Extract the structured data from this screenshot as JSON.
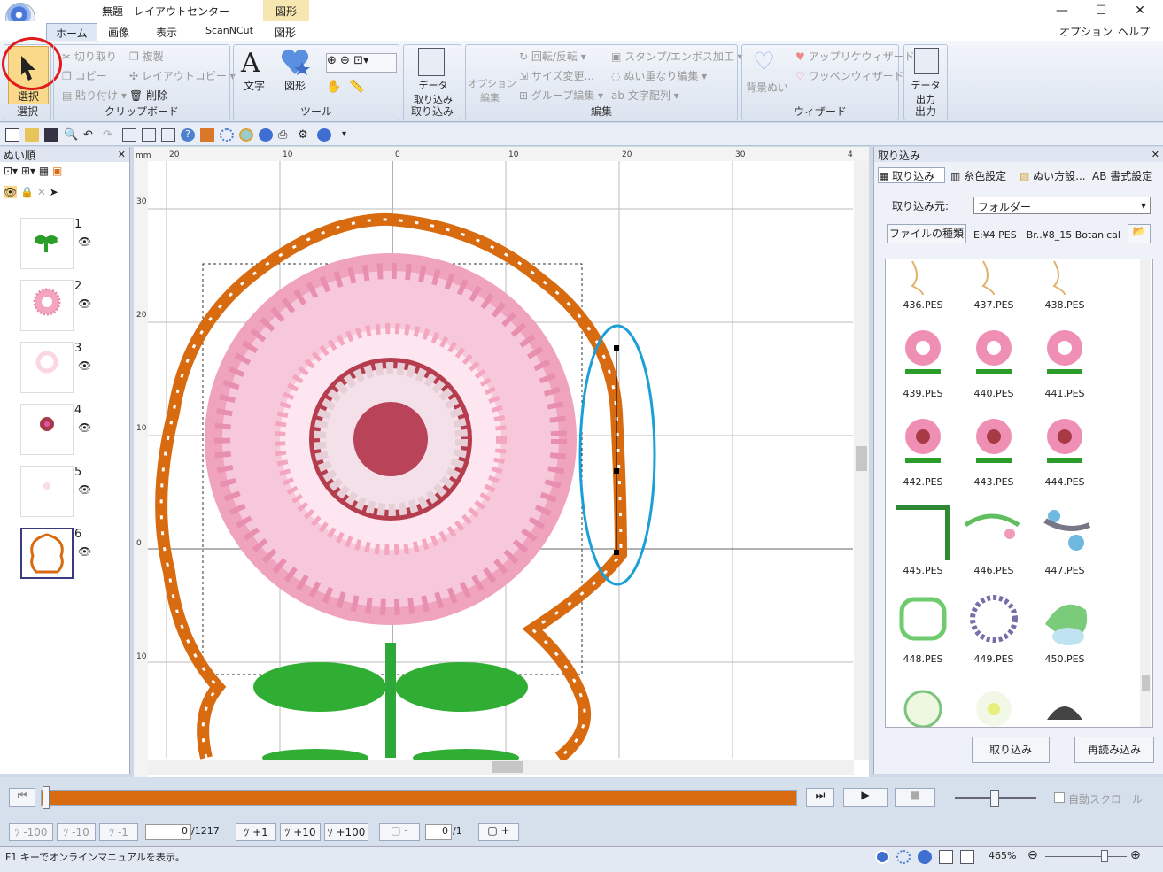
{
  "window": {
    "title": "無題 - レイアウトセンター",
    "context_tab": "図形",
    "minimize": "—",
    "maximize": "☐",
    "close": "✕"
  },
  "tabs": [
    "ホーム",
    "画像",
    "表示",
    "ScanNCut",
    "図形"
  ],
  "menu_right": {
    "options": "オプション",
    "help": "ヘルプ"
  },
  "ribbon": {
    "select": {
      "label": "選択",
      "group": "選択"
    },
    "clipboard": {
      "cut": "切り取り",
      "copy": "コピー",
      "paste": "貼り付け",
      "duplicate": "複製",
      "layout_copy": "レイアウトコピー",
      "delete": "削除",
      "group": "クリップボード"
    },
    "tools": {
      "text": "文字",
      "shape": "図形",
      "group": "ツール"
    },
    "import": {
      "label": "データ\n取り込み",
      "group": "取り込み"
    },
    "edit": {
      "options": "オプション\n編集",
      "rotate": "回転/反転",
      "resize": "サイズ変更...",
      "group_edit": "グループ編集",
      "stamp": "スタンプ/エンボス加工",
      "overlap": "ぬい重なり編集",
      "text_array": "文字配列",
      "group": "編集"
    },
    "wizard": {
      "bg": "背景ぬい",
      "applique": "アップリケウィザード",
      "patch": "ワッペンウィザード",
      "group": "ウィザード"
    },
    "output": {
      "label": "データ\n出力",
      "group": "出力"
    }
  },
  "left_panel": {
    "title": "ぬい順",
    "items": [
      {
        "num": "1"
      },
      {
        "num": "2"
      },
      {
        "num": "3"
      },
      {
        "num": "4"
      },
      {
        "num": "5"
      },
      {
        "num": "6"
      }
    ]
  },
  "ruler": {
    "unit": "mm",
    "h_ticks": [
      "20",
      "10",
      "0",
      "10",
      "20",
      "30",
      "4"
    ],
    "v_ticks": [
      "30",
      "20",
      "10",
      "0",
      "10"
    ]
  },
  "right_panel": {
    "title": "取り込み",
    "tabs": [
      "取り込み",
      "糸色設定",
      "ぬい方設...",
      "AB 書式設定"
    ],
    "source_label": "取り込み元:",
    "source_value": "フォルダー",
    "filetype_btn": "ファイルの種類",
    "path": "E:¥4 PES　Br..¥8_15 Botanical",
    "files": [
      "436.PES",
      "437.PES",
      "438.PES",
      "439.PES",
      "440.PES",
      "441.PES",
      "442.PES",
      "443.PES",
      "444.PES",
      "445.PES",
      "446.PES",
      "447.PES",
      "448.PES",
      "449.PES",
      "450.PES"
    ],
    "import_btn": "取り込み",
    "reload_btn": "再読み込み"
  },
  "playback": {
    "auto_scroll": "自動スクロール",
    "progress": 1.0
  },
  "stitch_nav": {
    "m100": "-100",
    "m10": "-10",
    "m1": "-1",
    "stitch_value": "0",
    "stitch_total": "/1217",
    "p1": "+1",
    "p10": "+10",
    "p100": "+100",
    "minus": "-",
    "color_value": "0",
    "color_total": "/1",
    "plus": "+"
  },
  "status": {
    "text": "F1 キーでオンラインマニュアルを表示。",
    "zoom": "465%"
  },
  "colors": {
    "accent_orange": "#d86a10",
    "ribbon_bg": "#dbe3ef",
    "highlight_red": "#e01b1b",
    "highlight_blue": "#1a9fd8"
  }
}
